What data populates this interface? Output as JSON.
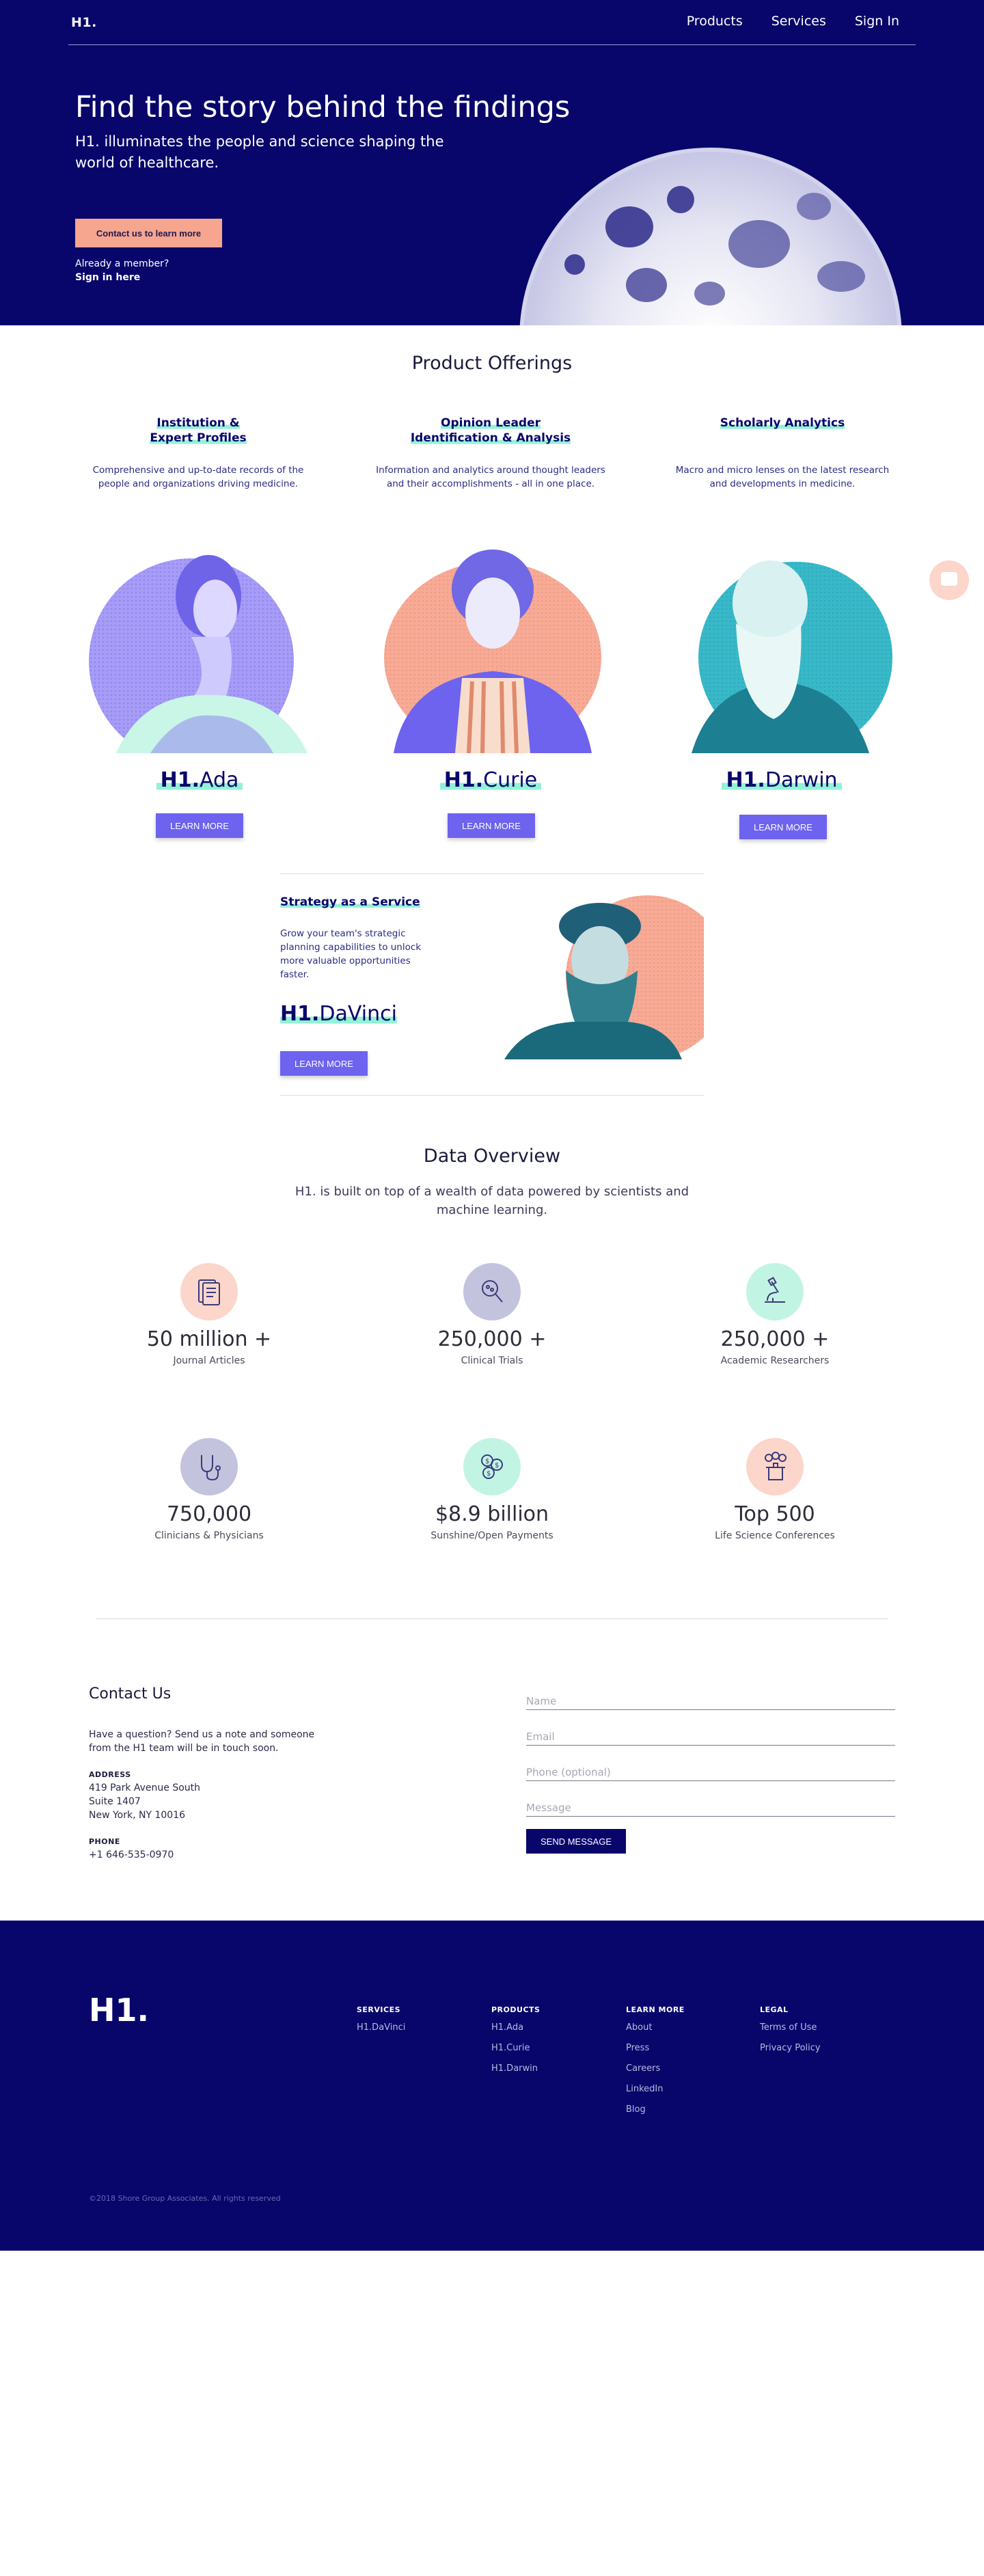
{
  "header": {
    "logo": "H1.",
    "nav": [
      "Products",
      "Services",
      "Sign In"
    ]
  },
  "hero": {
    "title": "Find the story behind the findings",
    "subtitle": "H1. illuminates the people and science shaping the world of healthcare.",
    "cta": "Contact us to learn more",
    "member_text": "Already a member?",
    "signin_link": "Sign in here"
  },
  "offerings": {
    "title": "Product Offerings",
    "items": [
      {
        "title_1": "Institution &",
        "title_2": "Expert Profiles",
        "desc": "Comprehensive and up-to-date records of the people and organizations driving medicine.",
        "brand_bold": "H1.",
        "brand_name": "Ada",
        "button": "LEARN MORE"
      },
      {
        "title_1": "Opinion Leader",
        "title_2": "Identification & Analysis",
        "desc": "Information and analytics around thought leaders and their accomplishments - all in one place.",
        "brand_bold": "H1.",
        "brand_name": "Curie",
        "button": "LEARN MORE"
      },
      {
        "title_1": "Scholarly Analytics",
        "title_2": "",
        "desc": "Macro and micro lenses on the latest research and developments in medicine.",
        "brand_bold": "H1.",
        "brand_name": "Darwin",
        "button": "LEARN MORE"
      }
    ]
  },
  "strategy": {
    "title": "Strategy as a Service",
    "desc": "Grow your team's strategic planning capabilities to unlock more valuable opportunities faster.",
    "brand_bold": "H1.",
    "brand_name": "DaVinci",
    "button": "LEARN MORE"
  },
  "data_overview": {
    "title": "Data Overview",
    "subtitle": "H1. is built on top of a wealth of data powered by scientists and machine learning.",
    "stats": [
      {
        "value": "50 million +",
        "label": "Journal Articles",
        "icon": "journal-icon",
        "color": "#fcd6cb"
      },
      {
        "value": "250,000 +",
        "label": "Clinical Trials",
        "icon": "magnifier-icon",
        "color": "#c4c3dd"
      },
      {
        "value": "250,000 +",
        "label": "Academic Researchers",
        "icon": "microscope-icon",
        "color": "#c2f4e4"
      },
      {
        "value": "750,000",
        "label": "Clinicians & Physicians",
        "icon": "stethoscope-icon",
        "color": "#c4c3dd"
      },
      {
        "value": "$8.9 billion",
        "label": "Sunshine/Open Payments",
        "icon": "coins-icon",
        "color": "#c2f4e4"
      },
      {
        "value": "Top 500",
        "label": "Life Science Conferences",
        "icon": "podium-icon",
        "color": "#fcd6cb"
      }
    ]
  },
  "contact": {
    "title": "Contact Us",
    "text": "Have a question? Send us a note and someone from the H1 team will be in touch soon.",
    "address_label": "ADDRESS",
    "address_1": "419 Park Avenue South",
    "address_2": "Suite 1407",
    "address_3": "New York, NY 10016",
    "phone_label": "PHONE",
    "phone": "+1 646-535-0970",
    "fields": {
      "name": "Name",
      "email": "Email",
      "phone": "Phone (optional)",
      "message": "Message"
    },
    "send": "SEND MESSAGE"
  },
  "footer": {
    "logo": "H1.",
    "columns": [
      {
        "heading": "SERVICES",
        "links": [
          "H1.DaVinci"
        ]
      },
      {
        "heading": "PRODUCTS",
        "links": [
          "H1.Ada",
          "H1.Curie",
          "H1.Darwin"
        ]
      },
      {
        "heading": "LEARN MORE",
        "links": [
          "About",
          "Press",
          "Careers",
          "LinkedIn",
          "Blog"
        ]
      },
      {
        "heading": "LEGAL",
        "links": [
          "Terms of Use",
          "Privacy Policy"
        ]
      }
    ],
    "copyright": "©2018 Shore Group Associates. All rights reserved"
  }
}
